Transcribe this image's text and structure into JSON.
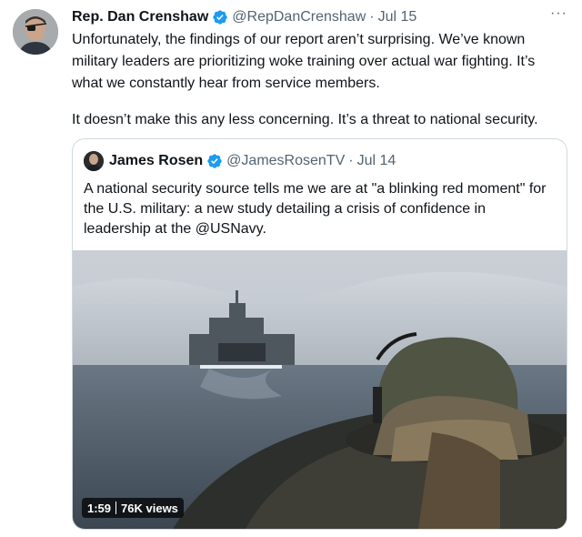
{
  "tweet": {
    "author_name": "Rep. Dan Crenshaw",
    "author_handle": "@RepDanCrenshaw",
    "separator": "·",
    "date": "Jul 15",
    "more_label": "···",
    "paragraph_1": "Unfortunately, the findings of our report aren’t surprising. We’ve known military leaders are prioritizing woke training over actual war fighting. It’s what we constantly hear from service members.",
    "paragraph_2": "It doesn’t make this any less concerning. It’s a threat to national security."
  },
  "quoted_tweet": {
    "author_name": "James Rosen",
    "author_handle": "@JamesRosenTV",
    "separator": "·",
    "date": "Jul 14",
    "text": "A national security source tells me we are at \"a blinking red moment\" for the U.S. military: a new study detailing a crisis of confidence in leadership at the @USNavy.",
    "video": {
      "duration": "1:59",
      "views": "76K views"
    }
  },
  "colors": {
    "verified": "#1d9bf0",
    "secondary_text": "#536471",
    "border": "#cfd9de"
  },
  "icons": [
    "verified-badge-icon",
    "more-icon"
  ]
}
